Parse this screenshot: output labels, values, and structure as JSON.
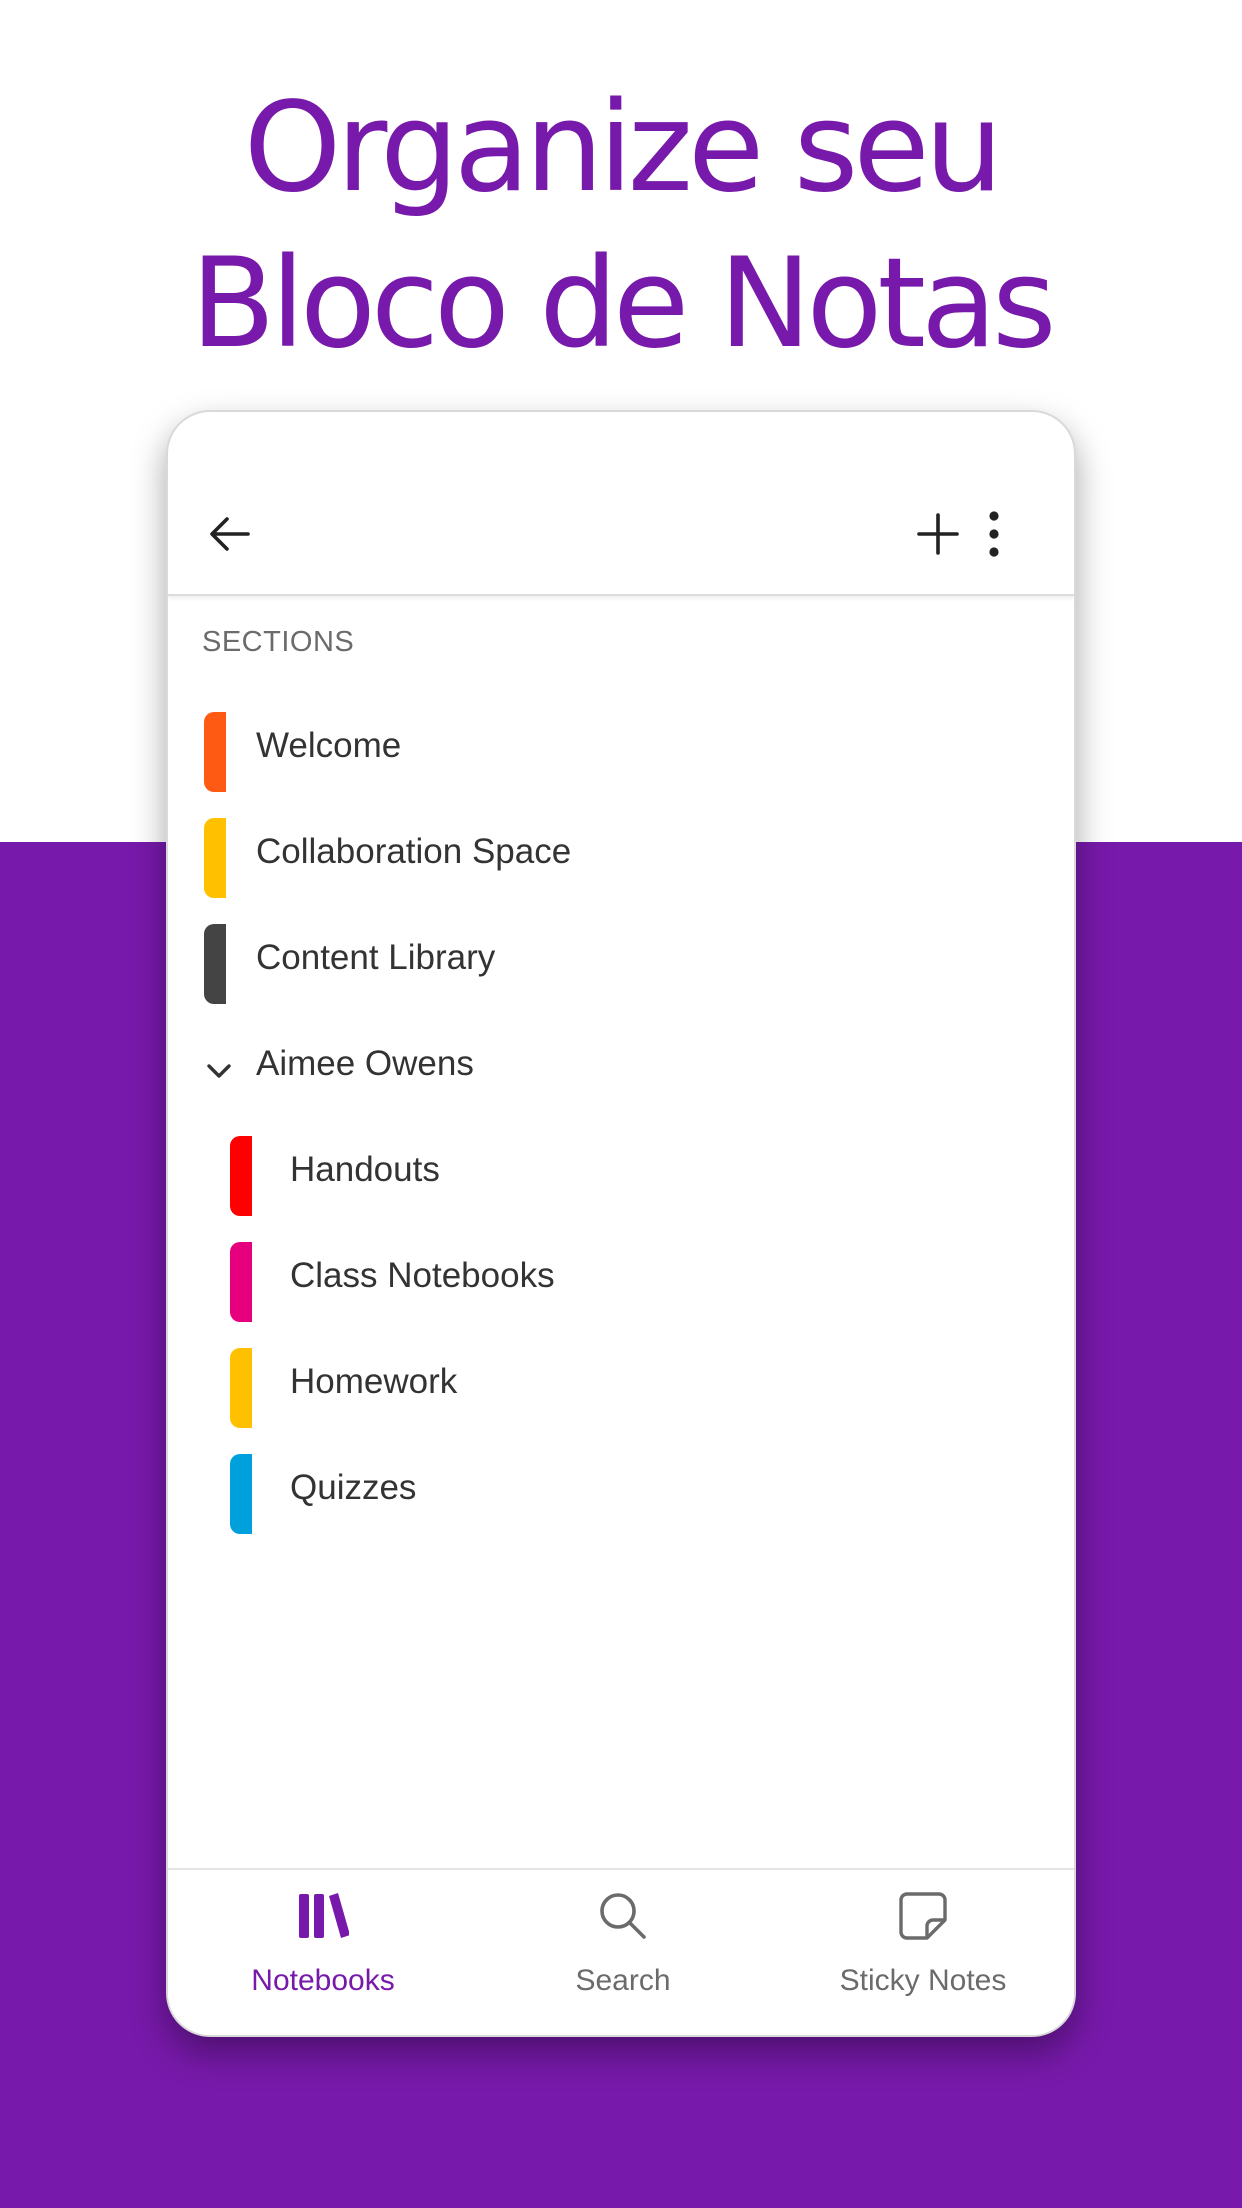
{
  "headline": {
    "line1": "Organize seu",
    "line2": "Bloco de Notas"
  },
  "colors": {
    "brand_purple": "#7719aa",
    "text_dark": "#333333",
    "text_muted": "#6b6b6b"
  },
  "app_bar": {
    "back_icon": "arrow-left-icon",
    "add_icon": "plus-icon",
    "more_icon": "more-vertical-icon"
  },
  "sections": {
    "header": "SECTIONS",
    "items": [
      {
        "label": "Welcome",
        "color": "#ff5a13"
      },
      {
        "label": "Collaboration Space",
        "color": "#ffc000"
      },
      {
        "label": "Content Library",
        "color": "#444444"
      }
    ],
    "group": {
      "label": "Aimee Owens",
      "expanded": true,
      "items": [
        {
          "label": "Handouts",
          "color": "#ff0000"
        },
        {
          "label": "Class Notebooks",
          "color": "#e6007e"
        },
        {
          "label": "Homework",
          "color": "#ffc000"
        },
        {
          "label": "Quizzes",
          "color": "#00a0dc"
        }
      ]
    }
  },
  "bottom_nav": {
    "items": [
      {
        "label": "Notebooks",
        "icon": "notebooks-icon",
        "active": true
      },
      {
        "label": "Search",
        "icon": "search-icon",
        "active": false
      },
      {
        "label": "Sticky Notes",
        "icon": "sticky-note-icon",
        "active": false
      }
    ]
  }
}
